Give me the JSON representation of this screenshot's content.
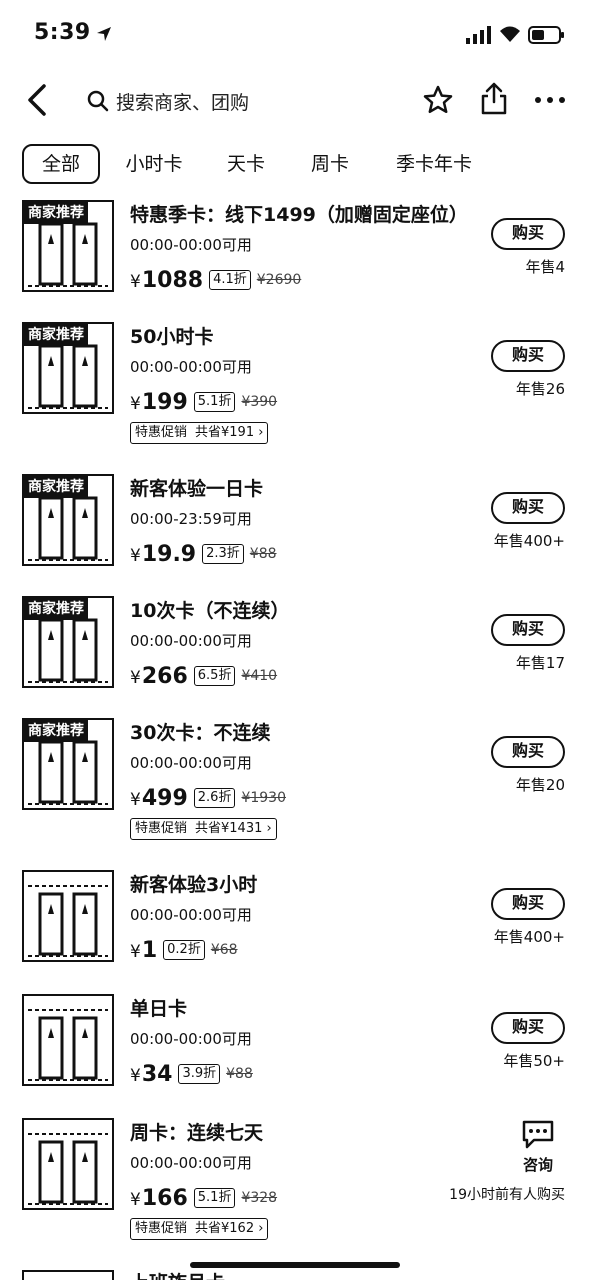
{
  "status": {
    "time": "5:39"
  },
  "search": {
    "placeholder": "搜索商家、团购"
  },
  "tabs": [
    "全部",
    "小时卡",
    "天卡",
    "周卡",
    "季卡年卡"
  ],
  "rec_badge": "商家推荐",
  "buy_label": "购买",
  "items": [
    {
      "title": "特惠季卡：线下1499（加赠固定座位）",
      "time": "00:00-00:00可用",
      "price": "1088",
      "discount": "4.1折",
      "orig": "¥2690",
      "sales": "年售4",
      "recommended": true
    },
    {
      "title": "50小时卡",
      "time": "00:00-00:00可用",
      "price": "199",
      "discount": "5.1折",
      "orig": "¥390",
      "promo_label": "特惠促销",
      "promo_save": "共省¥191",
      "sales": "年售26",
      "recommended": true
    },
    {
      "title": "新客体验一日卡",
      "time": "00:00-23:59可用",
      "price": "19.9",
      "discount": "2.3折",
      "orig": "¥88",
      "sales": "年售400+",
      "recommended": true
    },
    {
      "title": "10次卡（不连续）",
      "time": "00:00-00:00可用",
      "price": "266",
      "discount": "6.5折",
      "orig": "¥410",
      "sales": "年售17",
      "recommended": true
    },
    {
      "title": "30次卡：不连续",
      "time": "00:00-00:00可用",
      "price": "499",
      "discount": "2.6折",
      "orig": "¥1930",
      "promo_label": "特惠促销",
      "promo_save": "共省¥1431",
      "sales": "年售20",
      "recommended": true
    },
    {
      "title": "新客体验3小时",
      "time": "00:00-00:00可用",
      "price": "1",
      "discount": "0.2折",
      "orig": "¥68",
      "sales": "年售400+",
      "recommended": false
    },
    {
      "title": "单日卡",
      "time": "00:00-00:00可用",
      "price": "34",
      "discount": "3.9折",
      "orig": "¥88",
      "sales": "年售50+",
      "recommended": false
    },
    {
      "title": "周卡：连续七天",
      "time": "00:00-00:00可用",
      "price": "166",
      "discount": "5.1折",
      "orig": "¥328",
      "promo_label": "特惠促销",
      "promo_save": "共省¥162",
      "recommended": false,
      "consult_label": "咨询",
      "recent_buy": "19小时前有人购买"
    }
  ],
  "peek_title": "上班族月卡",
  "currency": "¥"
}
